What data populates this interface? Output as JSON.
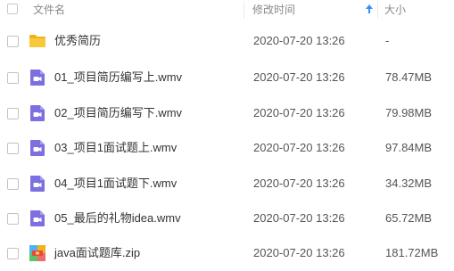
{
  "header": {
    "name_label": "文件名",
    "date_label": "修改时间",
    "size_label": "大小",
    "sort_icon": "arrow-up-icon"
  },
  "files": [
    {
      "name": "优秀简历",
      "modified": "2020-07-20 13:26",
      "size": "-",
      "icon": "folder-icon"
    },
    {
      "name": "01_项目简历编写上.wmv",
      "modified": "2020-07-20 13:26",
      "size": "78.47MB",
      "icon": "video-file-icon"
    },
    {
      "name": "02_项目简历编写下.wmv",
      "modified": "2020-07-20 13:26",
      "size": "79.98MB",
      "icon": "video-file-icon"
    },
    {
      "name": "03_项目1面试题上.wmv",
      "modified": "2020-07-20 13:26",
      "size": "97.84MB",
      "icon": "video-file-icon"
    },
    {
      "name": "04_项目1面试题下.wmv",
      "modified": "2020-07-20 13:26",
      "size": "34.32MB",
      "icon": "video-file-icon"
    },
    {
      "name": "05_最后的礼物idea.wmv",
      "modified": "2020-07-20 13:26",
      "size": "65.72MB",
      "icon": "video-file-icon"
    },
    {
      "name": "java面试题库.zip",
      "modified": "2020-07-20 13:26",
      "size": "181.72MB",
      "icon": "zip-file-icon"
    }
  ],
  "colors": {
    "folder": "#f8c83c",
    "video": "#7c6fe0",
    "sort_arrow": "#3b8cff"
  }
}
